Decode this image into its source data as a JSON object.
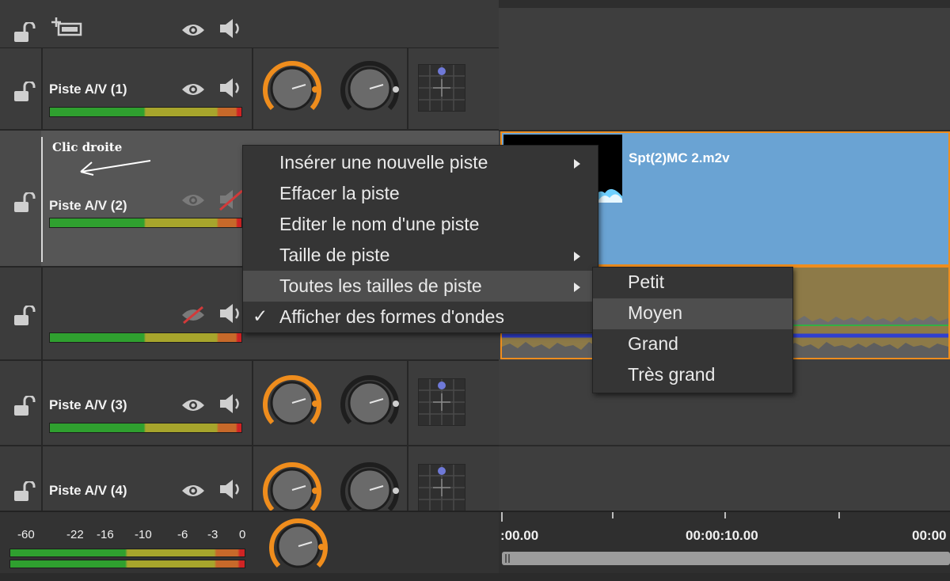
{
  "annotation": {
    "text": "Clic droite"
  },
  "tracks": [
    {
      "name": "Piste A/V (1)"
    },
    {
      "name": "Piste A/V (2)"
    },
    {
      "name": ""
    },
    {
      "name": "Piste A/V (3)"
    },
    {
      "name": "Piste A/V (4)"
    }
  ],
  "clip": {
    "filename": "Spt(2)MC 2.m2v"
  },
  "context_menu": {
    "items": [
      {
        "label": "Insérer une nouvelle piste",
        "submenu": true
      },
      {
        "label": "Effacer la piste"
      },
      {
        "label": "Editer le nom d'une piste"
      },
      {
        "label": "Taille de piste",
        "submenu": true
      },
      {
        "label": "Toutes les tailles de piste",
        "submenu": true,
        "highlighted": true
      },
      {
        "label": "Afficher des formes d'ondes",
        "checked": true,
        "check_glyph": "✓"
      }
    ]
  },
  "submenu": {
    "items": [
      {
        "label": "Petit"
      },
      {
        "label": "Moyen",
        "highlighted": true
      },
      {
        "label": "Grand"
      },
      {
        "label": "Très grand"
      }
    ]
  },
  "master_meter": {
    "scale": [
      "-60",
      "-22",
      "-16",
      "-10",
      "-6",
      "-3",
      "0"
    ]
  },
  "ruler": {
    "timecodes": [
      ":00.00",
      "00:00:10.00",
      "00:00"
    ]
  },
  "colors": {
    "accent": "#ef8d1d",
    "clip_blue": "#6aa3d3",
    "audio_gold": "#8d7a48",
    "waveform_line": "#2f3fd0"
  },
  "icons": [
    "lock-open-icon",
    "add-track-icon",
    "eye-icon",
    "speaker-icon",
    "eye-off-icon",
    "speaker-muted-icon",
    "volume-knob",
    "pan-knob",
    "pan-grid-icon"
  ]
}
